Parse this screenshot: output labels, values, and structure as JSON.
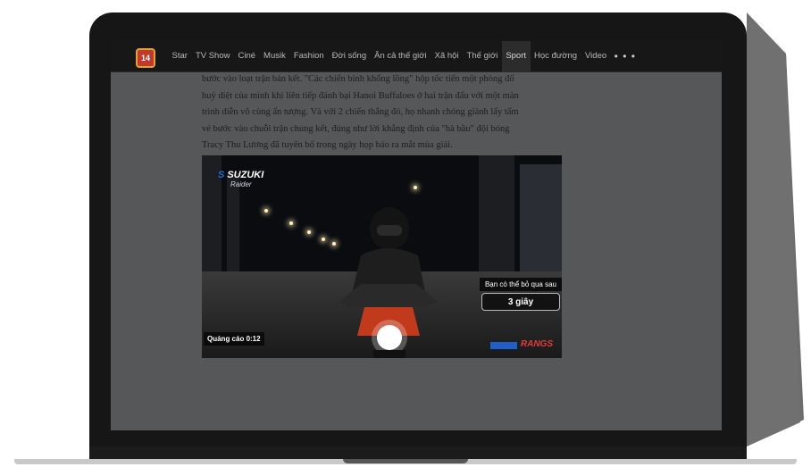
{
  "logo": {
    "text": "14"
  },
  "nav": {
    "items": [
      "Star",
      "TV Show",
      "Ciné",
      "Musik",
      "Fashion",
      "Đời sống",
      "Ăn cả thế giới",
      "Xã hội",
      "Thế giới",
      "Sport",
      "Học đường",
      "Video"
    ],
    "active": "Sport",
    "more_label": "• • •"
  },
  "article": {
    "lines": [
      "bước vào loạt trận bán kết. \"Các chiến binh khổng lồng\" hộp tốc tiến một phòng đố",
      "huỷ diệt của mình khi liên tiếp đánh bại Hanoi Buffaloes ở hai trận đấu với một màn",
      "trình diễn vô cùng ấn tượng. Và với 2 chiến thắng đó, họ nhanh chóng giành lấy tấm",
      "vé bước vào chuỗi trận chung kết, đúng như lời khẳng định của \"bà bầu\" đội bóng",
      "Tracy Thu Lương đã tuyên bố trong ngày họp báo ra mắt mùa giải."
    ]
  },
  "video": {
    "sponsor_logo": "SUZUKI",
    "sponsor_tagline": "Raider",
    "skip_caption": "Bạn có thể bỏ qua sau",
    "skip_button": "3 giây",
    "ad_timer": "Quảng cáo 0:12",
    "brand_name": "RANGS"
  },
  "colors": {
    "screen_bg": "#555759",
    "topbar_bg": "#171717",
    "bezel": "#161616",
    "accent_red": "#e23c3c"
  }
}
